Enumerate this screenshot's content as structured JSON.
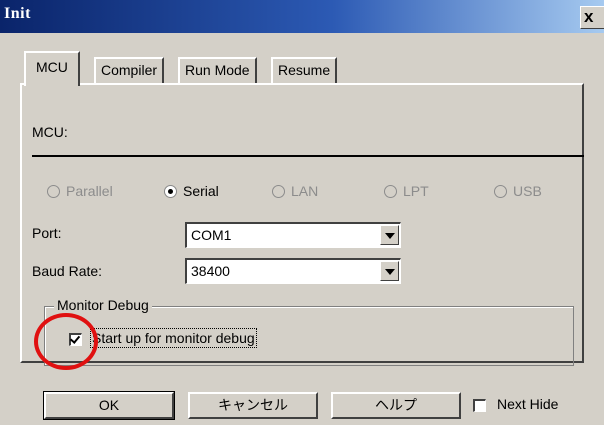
{
  "window": {
    "title": "Init",
    "close_label": "x"
  },
  "tabs": [
    {
      "label": "MCU",
      "active": true
    },
    {
      "label": "Compiler",
      "active": false
    },
    {
      "label": "Run Mode",
      "active": false
    },
    {
      "label": "Resume",
      "active": false
    }
  ],
  "mcu": {
    "label": "MCU:"
  },
  "connection": {
    "options": [
      {
        "label": "Parallel",
        "selected": false,
        "enabled": false
      },
      {
        "label": "Serial",
        "selected": true,
        "enabled": true
      },
      {
        "label": "LAN",
        "selected": false,
        "enabled": false
      },
      {
        "label": "LPT",
        "selected": false,
        "enabled": false
      },
      {
        "label": "USB",
        "selected": false,
        "enabled": false
      }
    ]
  },
  "port": {
    "label": "Port:",
    "value": "COM1"
  },
  "baud_rate": {
    "label": "Baud Rate:",
    "value": "38400"
  },
  "monitor_debug": {
    "group_title": "Monitor Debug",
    "checkbox_label": "Start up for monitor debug",
    "checked": true
  },
  "buttons": {
    "ok": "OK",
    "cancel": "キャンセル",
    "help": "ヘルプ"
  },
  "next_hide": {
    "label": "Next Hide",
    "checked": false
  },
  "annotation": {
    "color": "#e01010"
  }
}
